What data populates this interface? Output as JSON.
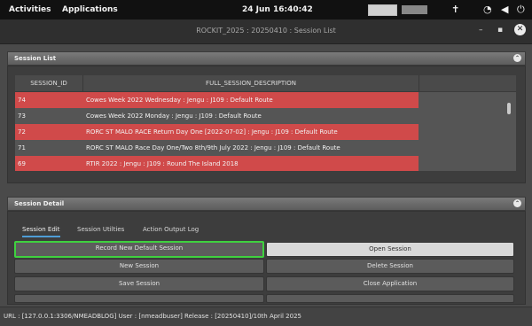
{
  "topbar": {
    "activities": "Activities",
    "applications": "Applications",
    "datetime": "24 Jun  16:40:42"
  },
  "window": {
    "title": "ROCKIT_2025 : 20250410 : Session List",
    "minimize": "–",
    "maximize": "▪",
    "close": "✕"
  },
  "session_list": {
    "header": "Session List",
    "columns": [
      "SESSION_ID",
      "FULL_SESSION_DESCRIPTION"
    ],
    "rows": [
      {
        "id": "74",
        "desc": "Cowes Week 2022 Wednesday : Jengu : J109 : Default Route",
        "style": "red"
      },
      {
        "id": "73",
        "desc": "Cowes Week 2022 Monday : Jengu : J109 : Default Route",
        "style": "gray"
      },
      {
        "id": "72",
        "desc": "RORC ST MALO RACE Return Day One  [2022-07-02] : Jengu : J109 : Default Route",
        "style": "red"
      },
      {
        "id": "71",
        "desc": "RORC ST MALO Race Day One/Two 8th/9th July 2022 : Jengu : J109 : Default Route",
        "style": "gray"
      },
      {
        "id": "69",
        "desc": "RTIR 2022 : Jengu : J109 : Round The Island 2018",
        "style": "red"
      }
    ]
  },
  "session_detail": {
    "header": "Session Detail",
    "tabs": [
      "Session Edit",
      "Session Utilties",
      "Action Output Log"
    ],
    "buttons": {
      "record": "Record New Default Session",
      "open": "Open Session",
      "new": "New Session",
      "delete": "Delete Session",
      "save": "Save Session",
      "close_app": "Close Application"
    }
  },
  "status": {
    "text": "URL : [127.0.0.1:3306/NMEADBLOG] User : [nmeadbuser] Release : [20250410]/10th April 2025"
  },
  "colors": {
    "row_highlight": "#d04a4a",
    "focus_border": "#3fd13f",
    "tab_underline": "#4f9dd6"
  }
}
